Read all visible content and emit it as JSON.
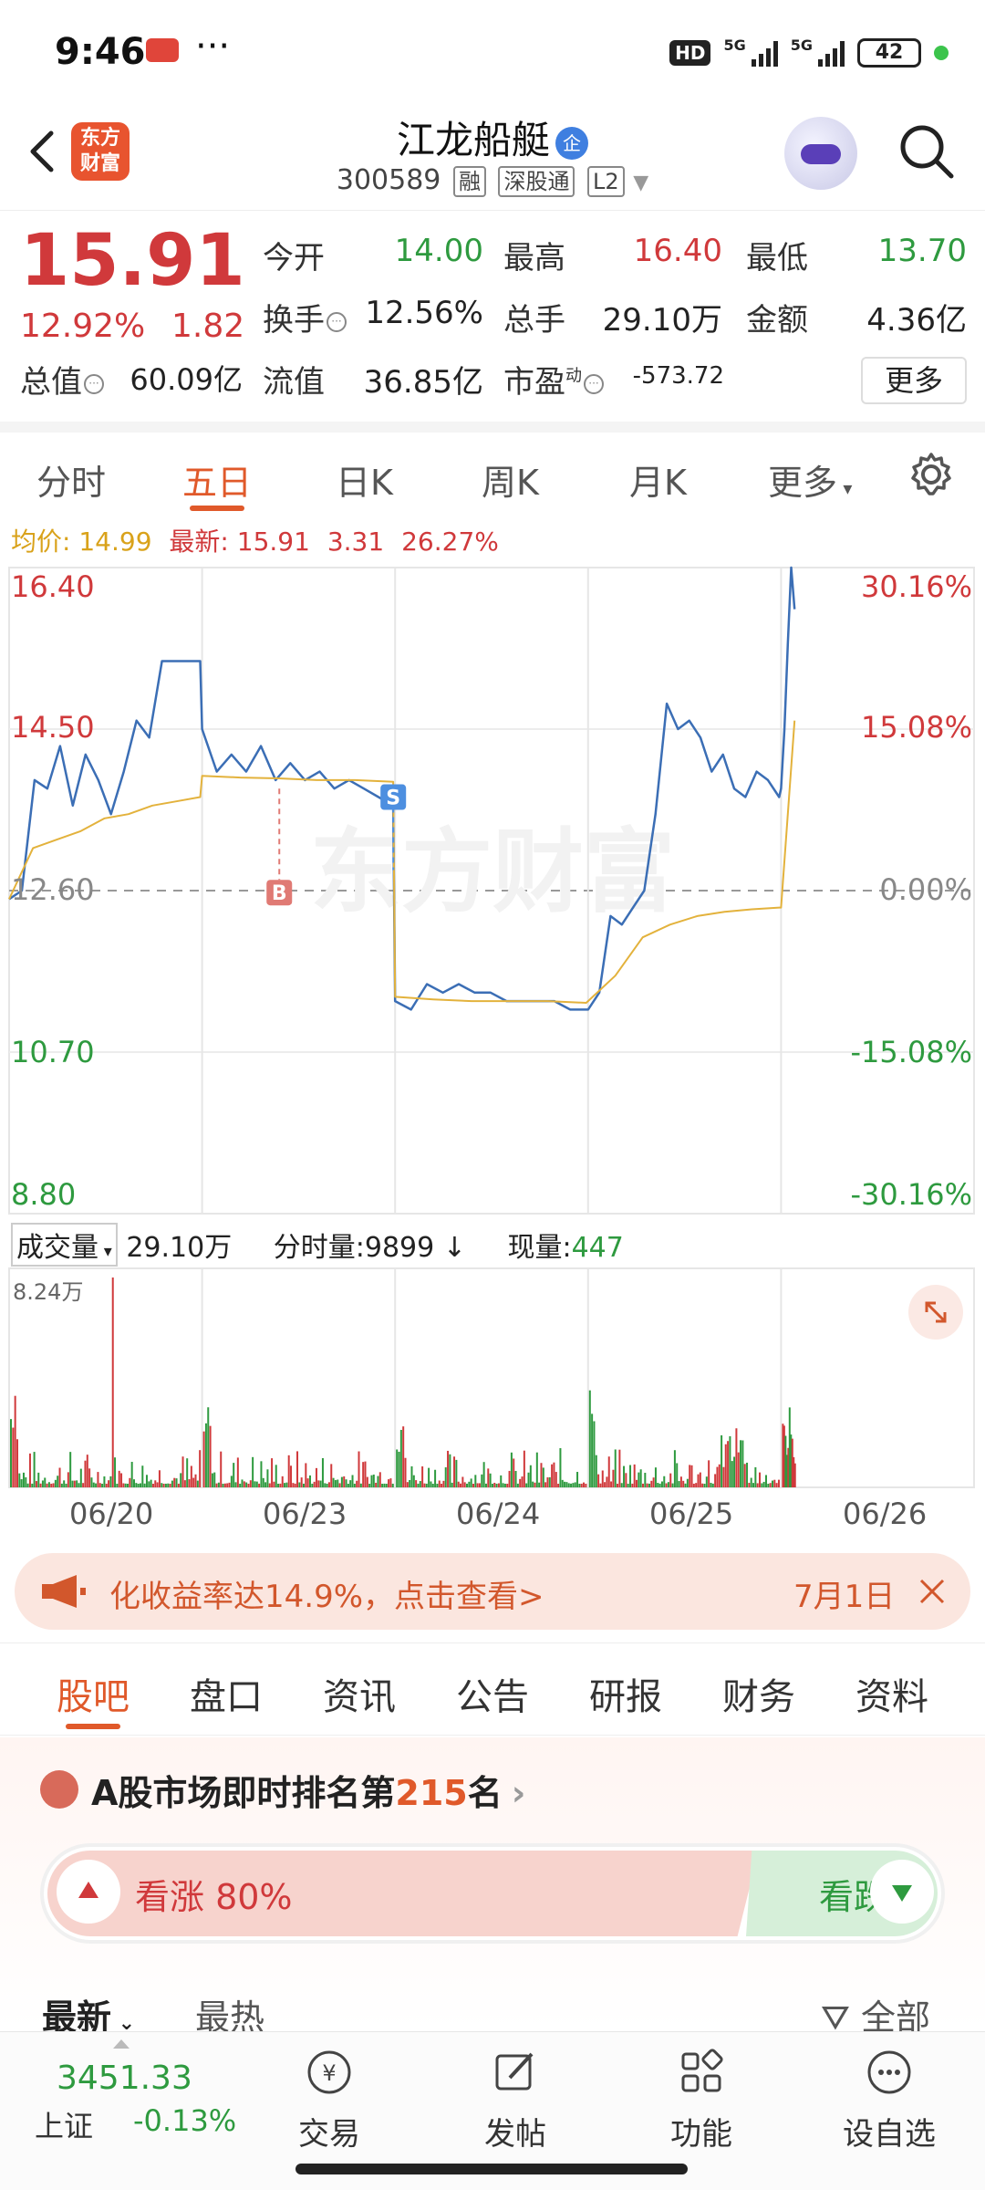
{
  "status_bar": {
    "time": "9:46",
    "dots": "···",
    "hd": "HD",
    "net1": "5G",
    "net2": "5G",
    "battery": "42"
  },
  "header": {
    "logo_text": "东方财富",
    "title": "江龙船艇",
    "qi_badge": "企",
    "code": "300589",
    "tags": [
      "融",
      "深股通",
      "L2"
    ]
  },
  "quote": {
    "price": "15.91",
    "change_pct": "12.92%",
    "change": "1.82",
    "fields": [
      {
        "label": "今开",
        "value": "14.00",
        "color": "green"
      },
      {
        "label": "最高",
        "value": "16.40",
        "color": "red"
      },
      {
        "label": "最低",
        "value": "13.70",
        "color": "green"
      },
      {
        "label": "换手",
        "value": "12.56%",
        "color": "black"
      },
      {
        "label": "总手",
        "value": "29.10万",
        "color": "black"
      },
      {
        "label": "金额",
        "value": "4.36亿",
        "color": "black"
      },
      {
        "label": "总值",
        "value": "60.09亿",
        "color": "black"
      },
      {
        "label": "流值",
        "value": "36.85亿",
        "color": "black"
      },
      {
        "label": "市盈",
        "value": "-573.72",
        "color": "black"
      }
    ],
    "pe_superscript": "动",
    "more_label": "更多"
  },
  "chart_tabs": [
    "分时",
    "五日",
    "日K",
    "周K",
    "月K",
    "更多"
  ],
  "chart_tabs_active": 1,
  "legend": {
    "avg_label": "均价:",
    "avg_value": "14.99",
    "latest_label": "最新:",
    "latest_value": "15.91",
    "chg": "3.31",
    "chg_pct": "26.27%"
  },
  "chart_data": {
    "type": "line",
    "y_left_ticks": [
      "16.40",
      "14.50",
      "12.60",
      "10.70",
      "8.80"
    ],
    "y_right_ticks": [
      "30.16%",
      "15.08%",
      "0.00%",
      "-15.08%",
      "-30.16%"
    ],
    "ylim": [
      8.8,
      16.4
    ],
    "x_labels": [
      "06/20",
      "06/23",
      "06/24",
      "06/25",
      "06/26"
    ],
    "watermark": "东方财富",
    "markers": [
      {
        "label": "B",
        "day": 1,
        "price": 13.8
      },
      {
        "label": "S",
        "day": 2,
        "price": 13.7
      }
    ],
    "series": [
      {
        "name": "price",
        "color": "#3b6eb5",
        "days": [
          [
            12.5,
            12.6,
            13.9,
            13.8,
            14.3,
            13.6,
            14.2,
            13.9,
            13.5,
            14.0,
            14.6,
            14.4,
            15.3,
            15.3,
            15.3,
            15.3
          ],
          [
            14.5,
            14.0,
            14.2,
            14.0,
            14.3,
            13.9,
            14.1,
            13.9,
            14.0,
            13.8,
            13.9,
            13.8,
            13.7,
            13.6
          ],
          [
            11.3,
            11.2,
            11.5,
            11.4,
            11.5,
            11.4,
            11.4,
            11.3,
            11.3,
            11.3,
            11.3,
            11.2,
            11.2
          ],
          [
            11.2,
            11.4,
            12.3,
            12.2,
            12.4,
            12.6,
            13.5,
            14.8,
            14.5,
            14.6,
            14.4,
            14.0,
            14.2,
            13.8,
            13.7,
            14.0,
            13.9,
            13.7
          ],
          [
            13.8,
            14.5,
            15.5,
            16.4,
            15.91
          ]
        ]
      },
      {
        "name": "average",
        "color": "#e3b23c",
        "days": [
          [
            12.5,
            13.1,
            13.2,
            13.3,
            13.45,
            13.5,
            13.6,
            13.65,
            13.7
          ],
          [
            13.95,
            13.93,
            13.92,
            13.9,
            13.9,
            13.88
          ],
          [
            11.35,
            11.32,
            11.3,
            11.3,
            11.3,
            11.28
          ],
          [
            11.3,
            11.6,
            12.05,
            12.2,
            12.3,
            12.35,
            12.38,
            12.4
          ],
          [
            12.4,
            13.5,
            14.6
          ]
        ]
      }
    ],
    "volume": {
      "label": "成交量",
      "total": "29.10万",
      "minute_label": "分时量:",
      "minute_value": "9899",
      "now_label": "现量:",
      "now_value": "447",
      "max_label": "8.24万"
    }
  },
  "promo": {
    "text": "化收益率达14.9%，点击查看>",
    "date": "7月1日"
  },
  "content_tabs": [
    "股吧",
    "盘口",
    "资讯",
    "公告",
    "研报",
    "财务",
    "资料"
  ],
  "content_tabs_active": 0,
  "rank": {
    "prefix": "A股市场即时排名第",
    "num": "215",
    "suffix": "名",
    "arrow": "›",
    "up_label": "看涨 80%",
    "down_label": "看跌"
  },
  "feed": {
    "latest": "最新",
    "hot": "最热",
    "all": "全部"
  },
  "bottom_bar": {
    "index_value": "3451.33",
    "index_name": "上证",
    "index_change": "-0.13%",
    "items": [
      "交易",
      "发帖",
      "功能",
      "设自选"
    ]
  }
}
